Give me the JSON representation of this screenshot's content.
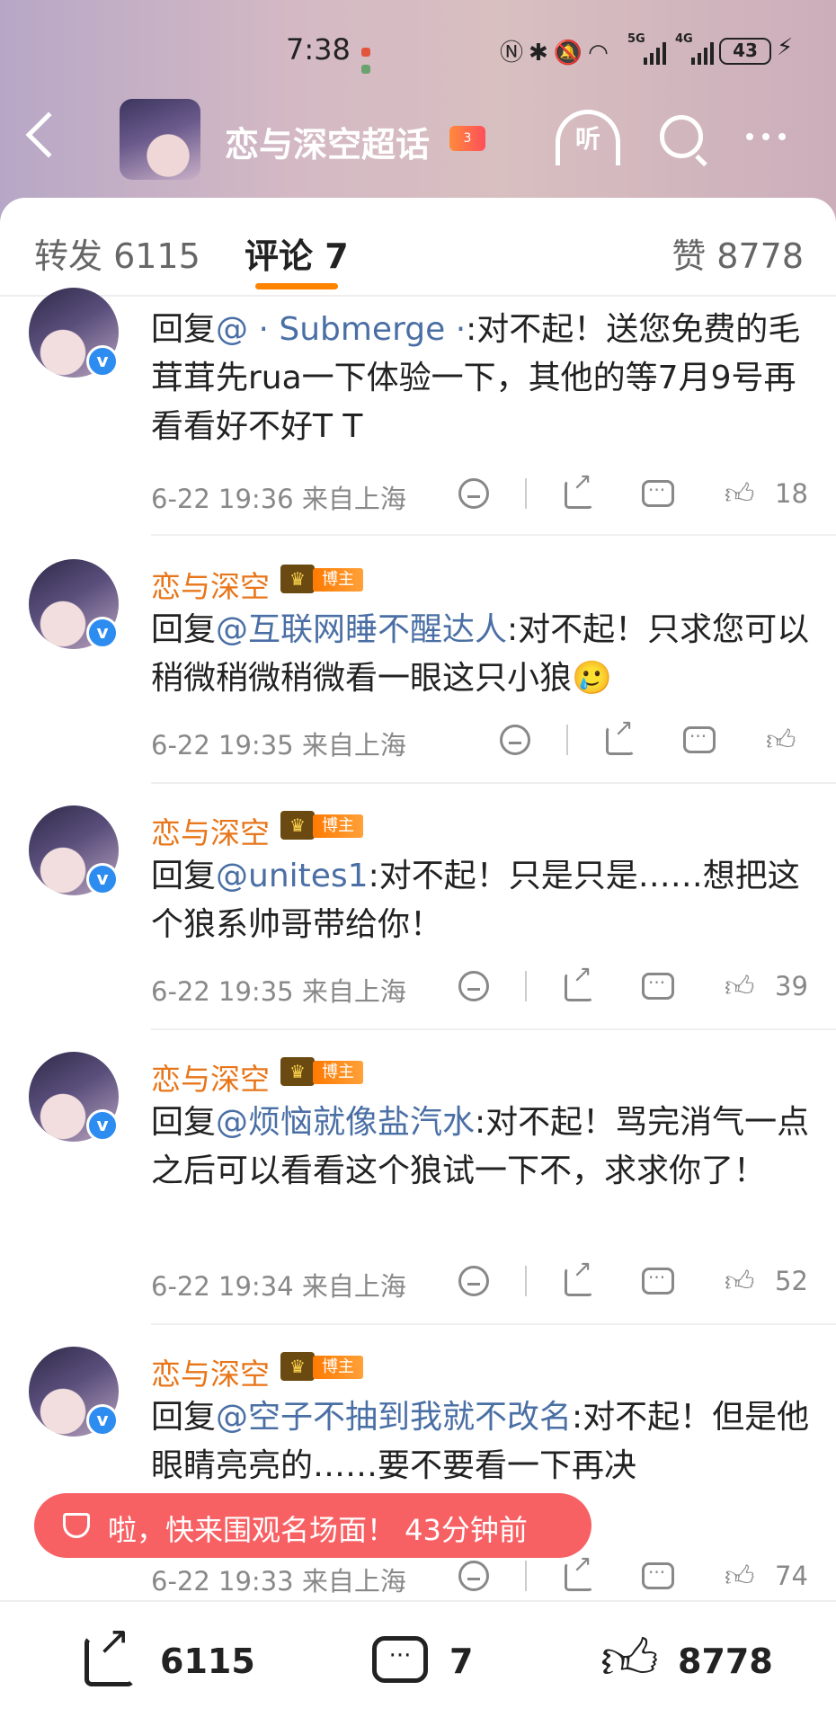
{
  "status_bar": {
    "time": "7:38",
    "net1": "5G",
    "net2": "4G",
    "battery": "43"
  },
  "header": {
    "title": "恋与深空超话",
    "badge": "3",
    "listen_label": "听"
  },
  "tabs": {
    "forward": "转发 6115",
    "comment": "评论 7",
    "like": "赞 8778"
  },
  "comments": [
    {
      "name": "",
      "reply_prefix": "回复",
      "mention": "@ · Submerge ·",
      "text": ":对不起！送您免费的毛茸茸先rua一下体验一下，其他的等7月9号再看看好不好T T",
      "time": "6-22 19:36 来自上海",
      "likes": "18"
    },
    {
      "name": "恋与深空",
      "badge": "博主",
      "reply_prefix": "回复",
      "mention": "@互联网睡不醒达人",
      "text": ":对不起！只求您可以稍微稍微稍微看一眼这只小狼🥲",
      "time": "6-22 19:35 来自上海",
      "likes": ""
    },
    {
      "name": "恋与深空",
      "badge": "博主",
      "reply_prefix": "回复",
      "mention": "@unites1",
      "text": ":对不起！只是只是……想把这个狼系帅哥带给你！",
      "time": "6-22 19:35 来自上海",
      "likes": "39"
    },
    {
      "name": "恋与深空",
      "badge": "博主",
      "reply_prefix": "回复",
      "mention": "@烦恼就像盐汽水",
      "text": ":对不起！骂完消气一点之后可以看看这个狼试一下不，求求你了！",
      "time": "6-22 19:34 来自上海",
      "likes": "52"
    },
    {
      "name": "恋与深空",
      "badge": "博主",
      "reply_prefix": "回复",
      "mention": "@空子不抽到我就不改名",
      "text": ":对不起！但是他眼睛亮亮的……要不要看一下再决",
      "time": "6-22 19:33 来自上海",
      "likes": "74"
    }
  ],
  "toast": {
    "text": "啦，快来围观名场面！ 43分钟前"
  },
  "bottom_bar": {
    "share_count": "6115",
    "comment_count": "7",
    "like_count": "8778"
  },
  "colors": {
    "accent": "#ff8200",
    "name": "#e8761a",
    "mention": "#4a6fa5",
    "toast": "#f7585c",
    "verified": "#2d8cf0"
  }
}
